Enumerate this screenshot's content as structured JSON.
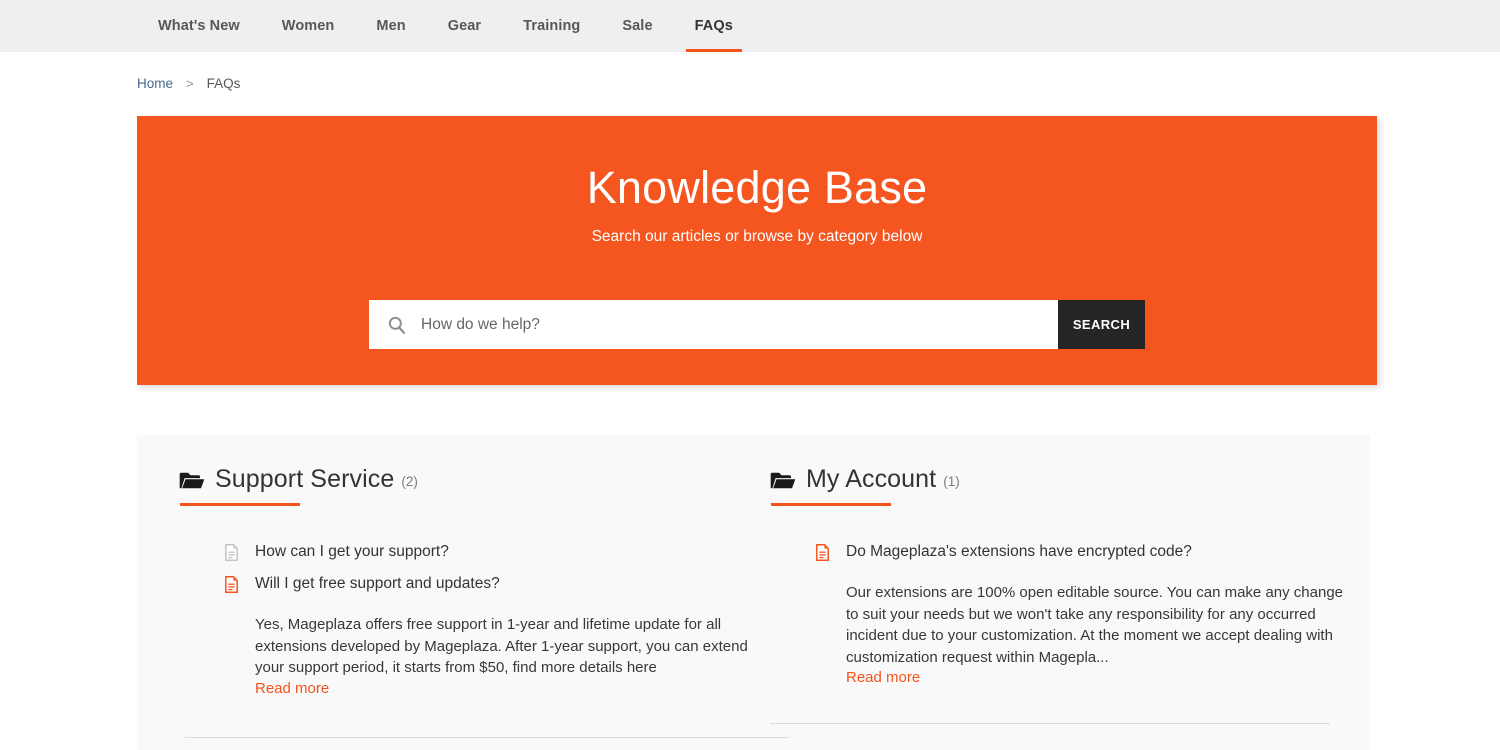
{
  "nav": {
    "items": [
      {
        "label": "What's New",
        "active": false
      },
      {
        "label": "Women",
        "active": false
      },
      {
        "label": "Men",
        "active": false
      },
      {
        "label": "Gear",
        "active": false
      },
      {
        "label": "Training",
        "active": false
      },
      {
        "label": "Sale",
        "active": false
      },
      {
        "label": "FAQs",
        "active": true
      }
    ]
  },
  "breadcrumb": {
    "home": "Home",
    "separator": ">",
    "current": "FAQs"
  },
  "hero": {
    "title": "Knowledge Base",
    "subtitle": "Search our articles or browse by category below",
    "background_color": "#f5551f",
    "search": {
      "icon": "search-icon",
      "value": "",
      "placeholder": "How do we help?",
      "button_label": "SEARCH",
      "button_color": "#252525"
    }
  },
  "accent_color": "#f4541c",
  "categories": [
    {
      "icon": "folder-open-icon",
      "title": "Support Service",
      "count": "(2)",
      "questions": [
        {
          "icon": "document-icon",
          "icon_state": "inactive",
          "text": "How can I get your support?",
          "expanded": false,
          "answer": "",
          "read_more": ""
        },
        {
          "icon": "document-icon",
          "icon_state": "active",
          "text": "Will I get free support and updates?",
          "expanded": true,
          "answer": "Yes, Mageplaza offers free support in 1-year and lifetime update for all extensions developed by Mageplaza. After 1-year support, you can extend your support period, it starts from $50, find more details here",
          "read_more": "Read more"
        }
      ]
    },
    {
      "icon": "folder-open-icon",
      "title": "My Account",
      "count": "(1)",
      "questions": [
        {
          "icon": "document-icon",
          "icon_state": "active",
          "text": "Do Mageplaza's extensions have encrypted code?",
          "expanded": true,
          "answer": "Our extensions are 100% open editable source. You can make any change to suit your needs but we won't take any responsibility for any occurred incident due to your customization. At the moment we accept dealing with customization request within Magepla...",
          "read_more": "Read more"
        }
      ]
    }
  ]
}
